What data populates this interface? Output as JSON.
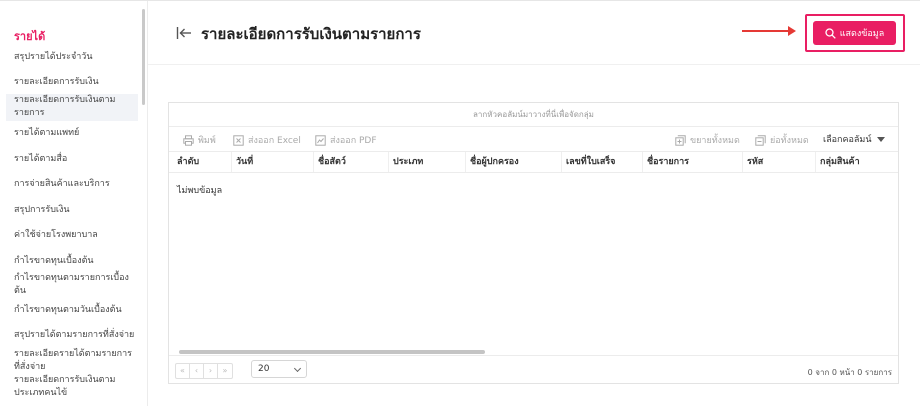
{
  "sidebar": {
    "heading": "รายได้",
    "items": [
      {
        "label": "สรุปรายได้ประจำวัน"
      },
      {
        "label": "รายละเอียดการรับเงิน"
      },
      {
        "label": "รายละเอียดการรับเงินตามรายการ"
      },
      {
        "label": "รายได้ตามแพทย์"
      },
      {
        "label": "รายได้ตามสื่อ"
      },
      {
        "label": "การจ่ายสินค้าและบริการ"
      },
      {
        "label": "สรุปการรับเงิน"
      },
      {
        "label": "ค่าใช้จ่ายโรงพยาบาล"
      },
      {
        "label": "กำไรขาดทุนเบื้องต้น"
      },
      {
        "label": "กำไรขาดทุนตามรายการเบื้องต้น"
      },
      {
        "label": "กำไรขาดทุนตามวันเบื้องต้น"
      },
      {
        "label": "สรุปรายได้ตามรายการที่สั่งจ่าย"
      },
      {
        "label": "รายละเอียดรายได้ตามรายการที่สั่งจ่าย"
      },
      {
        "label": "รายละเอียดการรับเงินตามประเภทคนไข้"
      }
    ]
  },
  "header": {
    "title": "รายละเอียดการรับเงินตามรายการ",
    "show_button": "แสดงข้อมูล"
  },
  "grid": {
    "group_panel": "ลากหัวคอลัมน์มาวางที่นี่เพื่อจัดกลุ่ม",
    "toolbar": {
      "print": "พิมพ์",
      "export_excel": "ส่งออก Excel",
      "export_pdf": "ส่งออก PDF",
      "expand_all": "ขยายทั้งหมด",
      "collapse_all": "ย่อทั้งหมด",
      "choose_columns": "เลือกคอลัมน์"
    },
    "columns": [
      "ลำดับ",
      "วันที่",
      "ชื่อสัตว์",
      "ประเภท",
      "ชื่อผู้ปกครอง",
      "เลขที่ใบเสร็จ",
      "ชื่อรายการ",
      "รหัส",
      "กลุ่มสินค้า"
    ],
    "empty_text": "ไม่พบข้อมูล",
    "pager": {
      "first": "«",
      "prev": "‹",
      "next": "›",
      "last": "»",
      "page_size": "20",
      "info": "0 จาก 0 หน้า 0 รายการ"
    }
  },
  "colors": {
    "accent": "#e91e63"
  }
}
